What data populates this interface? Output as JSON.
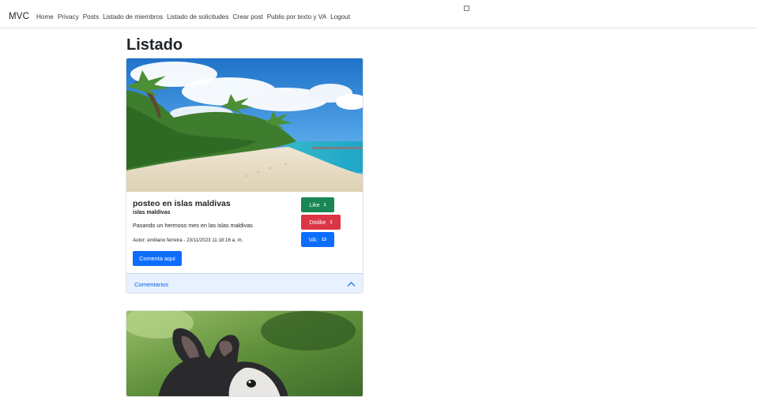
{
  "navbar": {
    "brand": "MVC",
    "links": [
      "Home",
      "Privacy",
      "Posts",
      "Listado de miembros",
      "Listado de solicitudes",
      "Crear post",
      "Publis por texto y VA",
      "Logout"
    ]
  },
  "page": {
    "title": "Listado"
  },
  "post": {
    "title": "posteo en islas maldivas",
    "subtitle": "islas maldivas",
    "body": "Pasando un hermoso mes en las islas maldivas",
    "author": "Autor: emiliano ferreira - 23/11/2023 11:18:16 a. m.",
    "comment_button": "Comenta aqui",
    "like_label": "Like",
    "like_count": "1",
    "dislike_label": "Dislike",
    "dislike_count": "1",
    "va_label": "VA:",
    "va_count": "13",
    "comments_label": "Comentarios"
  },
  "colors": {
    "like": "#198754",
    "dislike": "#dc3545",
    "primary": "#0d6efd",
    "accordion_bg": "#e7f1ff"
  },
  "icons": {
    "accordion": "chevron-up-icon",
    "cursor": "cursor-icon"
  }
}
